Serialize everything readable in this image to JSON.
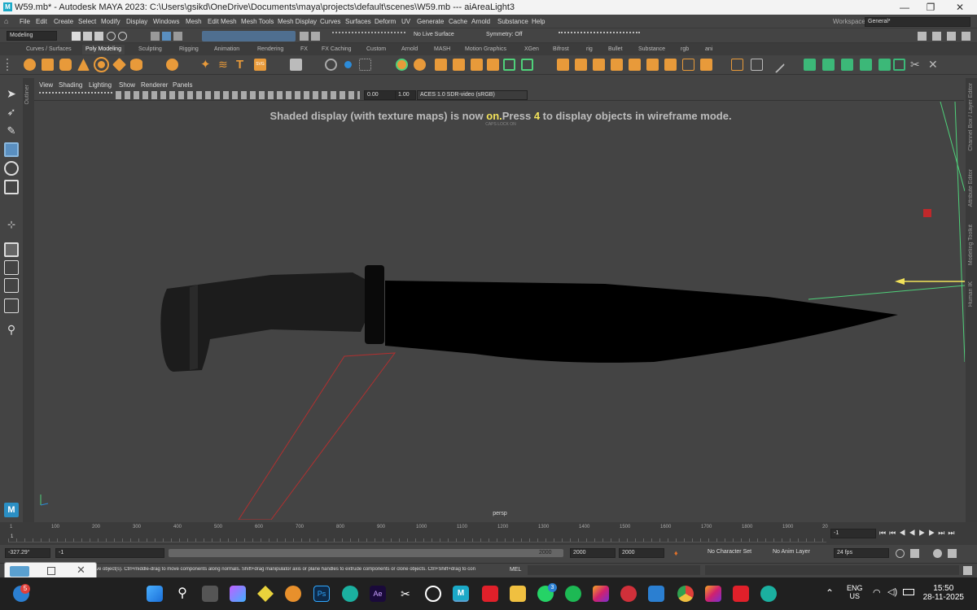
{
  "window": {
    "title": "W59.mb* - Autodesk MAYA 2023: C:\\Users\\gsikd\\OneDrive\\Documents\\maya\\projects\\default\\scenes\\W59.mb   ---   aiAreaLight3",
    "minimize": "—",
    "maximize": "❐",
    "close": "✕"
  },
  "menubar": {
    "items": [
      "File",
      "Edit",
      "Create",
      "Select",
      "Modify",
      "Display",
      "Windows",
      "Mesh",
      "Edit Mesh",
      "Mesh Tools",
      "Mesh Display",
      "Curves",
      "Surfaces",
      "Deform",
      "UV",
      "Generate",
      "Cache",
      "Arnold",
      "Substance",
      "Help"
    ],
    "workspace_label": "Workspace:",
    "workspace_value": "General*"
  },
  "statusline": {
    "mode": "Modeling",
    "live_surface": "No Live Surface",
    "symmetry": "Symmetry: Off"
  },
  "shelf_tabs": [
    "Curves / Surfaces",
    "Poly Modeling",
    "Sculpting",
    "Rigging",
    "Animation",
    "Rendering",
    "FX",
    "FX Caching",
    "Custom",
    "Arnold",
    "MASH",
    "Motion Graphics",
    "XGen",
    "Bifrost",
    "rig",
    "Bullet",
    "Substance",
    "rgb",
    "ani"
  ],
  "shelf_active": "Poly Modeling",
  "panel_menu": [
    "View",
    "Shading",
    "Lighting",
    "Show",
    "Renderer",
    "Panels"
  ],
  "panel_toolbar": {
    "exposure": "0.00",
    "gamma": "1.00",
    "color_space": "ACES 1.0 SDR-video (sRGB)"
  },
  "viewport": {
    "hud_before": "Shaded display (with texture maps) is now ",
    "hud_on": "on.",
    "hud_press": "Press ",
    "hud_key": "4",
    "hud_after": " to display objects in wireframe mode.",
    "capslock": "CAPS LOCK ON",
    "camera": "persp"
  },
  "side_labels": {
    "left": "Outliner",
    "right": [
      "Channel Box / Layer Editor",
      "Attribute Editor",
      "Modeling Toolkit",
      "Human IK"
    ]
  },
  "timeline": {
    "ticks": [
      "1",
      "100",
      "200",
      "300",
      "400",
      "500",
      "600",
      "700",
      "800",
      "900",
      "1000",
      "1100",
      "1200",
      "1300",
      "1400",
      "1500",
      "1600",
      "1700",
      "1800",
      "1900",
      "20"
    ],
    "current_frame": "-1",
    "playback_start": "-327.29°",
    "range_start": "-1",
    "range_end": "2000",
    "anim_end": "2000",
    "total_end": "2000",
    "character_set": "No Character Set",
    "anim_layer": "No Anim Layer",
    "fps": "24 fps"
  },
  "cmdline": {
    "help_text": "ve object(s). Ctrl+middle-drag to move components along normals. Shift+drag manipulator axis or plane handles to extrude components or clone objects. Ctrl+Shift+drag to con",
    "lang": "MEL"
  },
  "taskbar": {
    "notification_count": "5",
    "badge_app": "3",
    "lang_top": "ENG",
    "lang_bottom": "US",
    "time": "15:50",
    "date": "28-11-2025"
  },
  "colors": {
    "accent": "#5aa0d0",
    "hud_yellow": "#f3e35a",
    "light_green": "#4fd17a",
    "light_red": "#c0282b",
    "viewport_bg": "#444444"
  }
}
